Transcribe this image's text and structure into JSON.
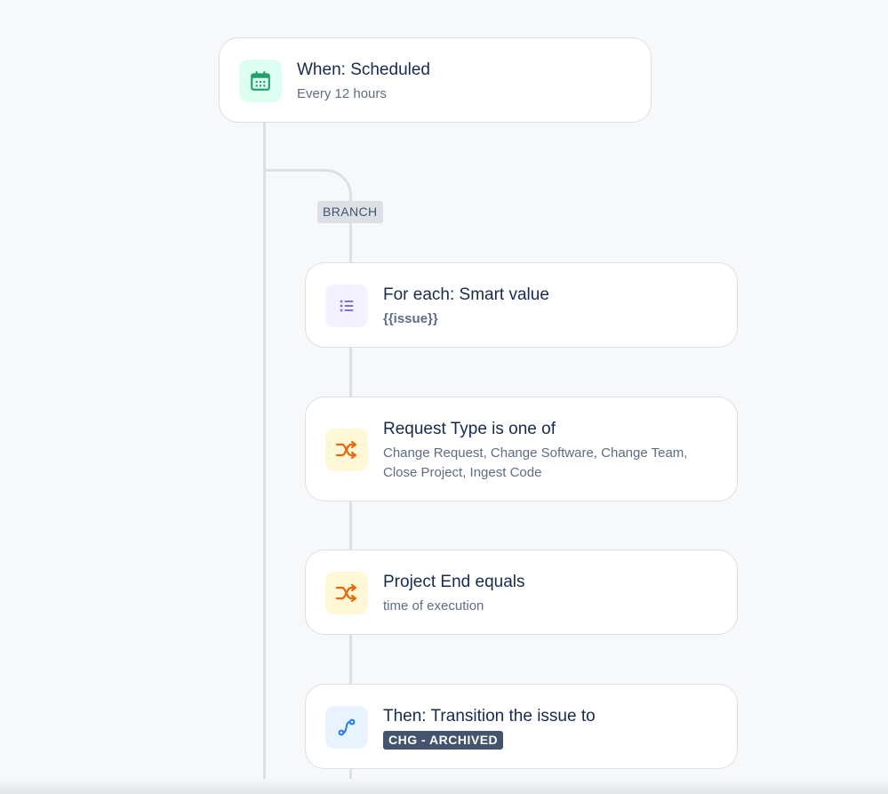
{
  "colors": {
    "trigger_icon_bg": "#dcfff1",
    "trigger_icon": "#22a06b",
    "branch_icon_bg": "#f3f0ff",
    "branch_icon": "#8270db",
    "condition_icon_bg": "#fff7d6",
    "condition_icon": "#e56910",
    "action_icon_bg": "#e9f2ff",
    "action_icon": "#1d7afc",
    "lozenge_bg": "#44546f"
  },
  "trigger": {
    "icon": "calendar-icon",
    "title": "When: Scheduled",
    "subtitle": "Every 12 hours"
  },
  "branch": {
    "tag": "BRANCH"
  },
  "for_each": {
    "icon": "list-icon",
    "title": "For each: Smart value",
    "subtitle": "{{issue}}"
  },
  "condition_request_type": {
    "icon": "shuffle-icon",
    "title": "Request Type is one of",
    "subtitle_line1": "Change Request, Change Software, Change Team,",
    "subtitle_line2": "Close Project, Ingest Code"
  },
  "condition_project_end": {
    "icon": "shuffle-icon",
    "title": "Project End equals",
    "subtitle": "time of execution"
  },
  "action_transition": {
    "icon": "transition-icon",
    "title": "Then: Transition the issue to",
    "status": "CHG - ARCHIVED"
  }
}
